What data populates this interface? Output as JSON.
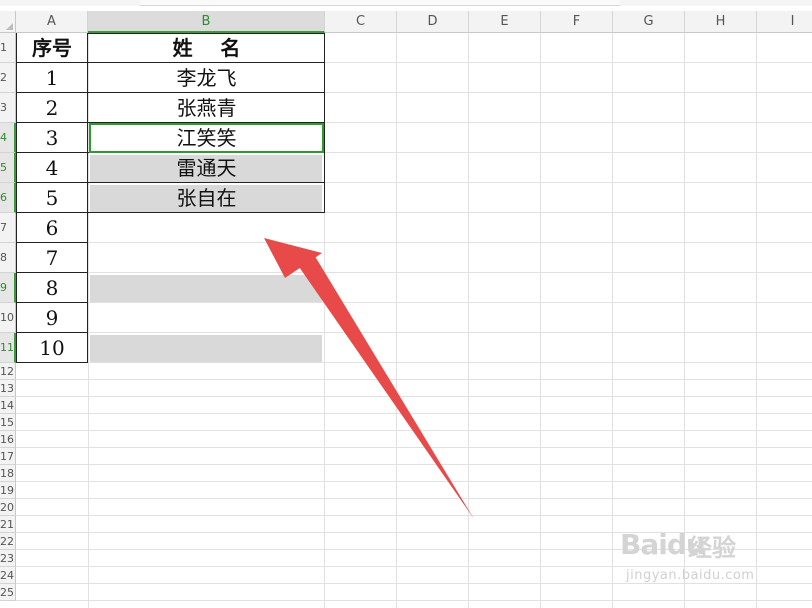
{
  "columns": [
    "A",
    "B",
    "C",
    "D",
    "E",
    "F",
    "G",
    "H",
    "I"
  ],
  "rows": [
    "1",
    "2",
    "3",
    "4",
    "5",
    "6",
    "7",
    "8",
    "9",
    "10",
    "11",
    "12",
    "13",
    "14",
    "15",
    "16",
    "17",
    "18",
    "19",
    "20",
    "21",
    "22",
    "23",
    "24",
    "25"
  ],
  "header": {
    "seq": "序号",
    "name": "姓    名"
  },
  "data_rows": [
    {
      "seq": "1",
      "name": "李龙飞"
    },
    {
      "seq": "2",
      "name": "张燕青"
    },
    {
      "seq": "3",
      "name": "江笑笑"
    },
    {
      "seq": "4",
      "name": "雷通天"
    },
    {
      "seq": "5",
      "name": "张自在"
    },
    {
      "seq": "6",
      "name": ""
    },
    {
      "seq": "7",
      "name": ""
    },
    {
      "seq": "8",
      "name": ""
    },
    {
      "seq": "9",
      "name": ""
    },
    {
      "seq": "10",
      "name": ""
    }
  ],
  "colors": {
    "selection": "#2f9a2f",
    "highlight_fill": "#d9d9d9",
    "arrow": "#e84a4a"
  },
  "watermark": {
    "brand": "Baidu",
    "product": "经验",
    "url": "jingyan.baidu.com"
  }
}
